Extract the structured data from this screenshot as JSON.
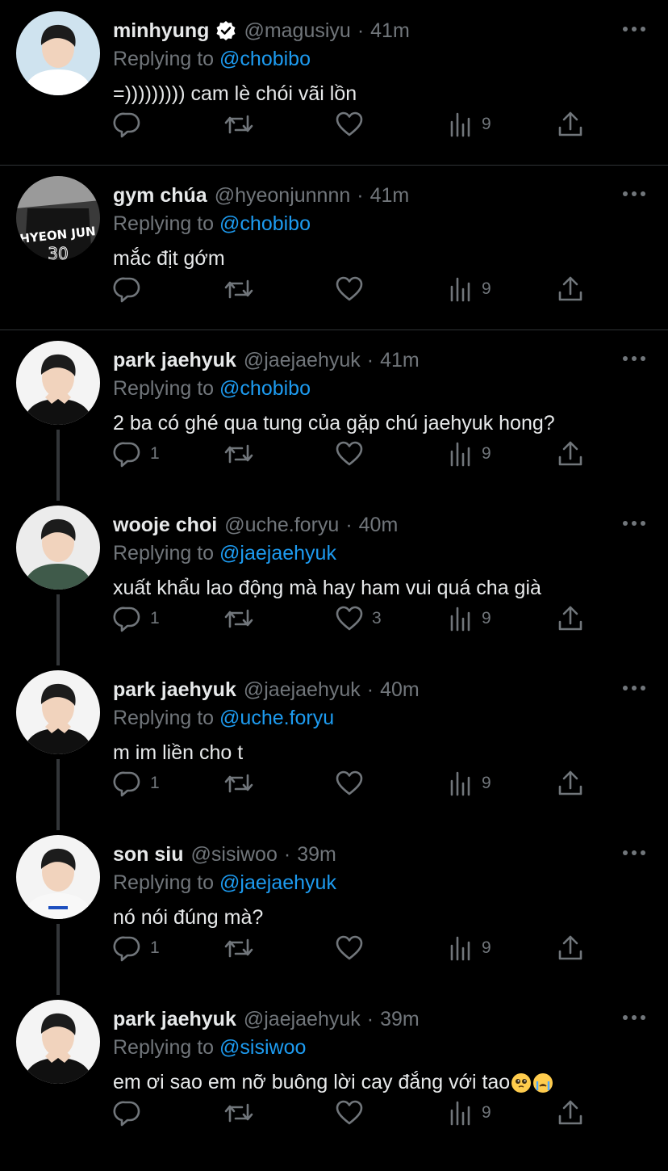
{
  "tweets": [
    {
      "name": "minhyung",
      "verified": true,
      "handle": "@magusiyu",
      "time": "41m",
      "replying_to_label": "Replying to",
      "replying_to": "@chobibo",
      "text": "=))))))))) cam lè chói vãi lồn",
      "replies": "",
      "retweets": "",
      "likes": "",
      "views": "9"
    },
    {
      "name": "gym chúa",
      "verified": false,
      "handle": "@hyeonjunnnn",
      "time": "41m",
      "replying_to_label": "Replying to",
      "replying_to": "@chobibo",
      "text": "mắc địt gớm",
      "replies": "",
      "retweets": "",
      "likes": "",
      "views": "9"
    },
    {
      "name": "park jaehyuk",
      "verified": false,
      "handle": "@jaejaehyuk",
      "time": "41m",
      "replying_to_label": "Replying to",
      "replying_to": "@chobibo",
      "text": "2 ba có ghé qua tung của gặp chú jaehyuk hong?",
      "replies": "1",
      "retweets": "",
      "likes": "",
      "views": "9"
    },
    {
      "name": "wooje choi",
      "verified": false,
      "handle": "@uche.foryu",
      "time": "40m",
      "replying_to_label": "Replying to",
      "replying_to": "@jaejaehyuk",
      "text": "xuất khẩu lao động mà hay ham vui quá cha già",
      "replies": "1",
      "retweets": "",
      "likes": "3",
      "views": "9"
    },
    {
      "name": "park jaehyuk",
      "verified": false,
      "handle": "@jaejaehyuk",
      "time": "40m",
      "replying_to_label": "Replying to",
      "replying_to": "@uche.foryu",
      "text": "m im liền cho t",
      "replies": "1",
      "retweets": "",
      "likes": "",
      "views": "9"
    },
    {
      "name": "son siu",
      "verified": false,
      "handle": "@sisiwoo",
      "time": "39m",
      "replying_to_label": "Replying to",
      "replying_to": "@jaejaehyuk",
      "text": "nó nói đúng mà?",
      "replies": "1",
      "retweets": "",
      "likes": "",
      "views": "9"
    },
    {
      "name": "park jaehyuk",
      "verified": false,
      "handle": "@jaejaehyuk",
      "time": "39m",
      "replying_to_label": "Replying to",
      "replying_to": "@sisiwoo",
      "text": "em ơi sao em nỡ buông lời cay đắng với tao",
      "emojis": [
        "pleading-face-emoji",
        "loudly-crying-face-emoji"
      ],
      "replies": "",
      "retweets": "",
      "likes": "",
      "views": "9"
    }
  ],
  "icons": {
    "reply": "reply-icon",
    "retweet": "retweet-icon",
    "like": "heart-icon",
    "views": "views-icon",
    "share": "share-icon",
    "more": "more-icon",
    "verified": "verified-badge-icon"
  },
  "colors": {
    "background": "#000000",
    "text": "#e7e9ea",
    "secondary": "#71767b",
    "link": "#1d9bf0",
    "divider": "#2f3336",
    "thread_line": "#333639"
  }
}
